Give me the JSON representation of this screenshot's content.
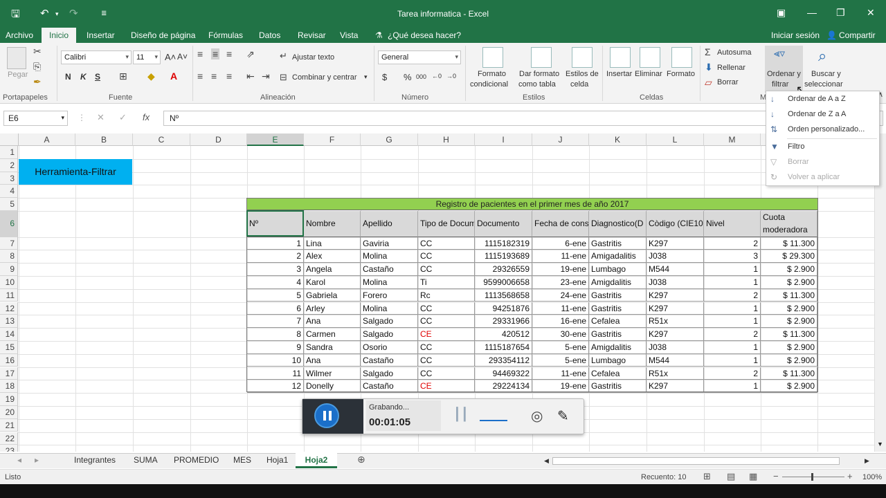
{
  "window": {
    "title": "Tarea informatica - Excel"
  },
  "menu": {
    "tabs": [
      "Archivo",
      "Inicio",
      "Insertar",
      "Diseño de página",
      "Fórmulas",
      "Datos",
      "Revisar",
      "Vista"
    ],
    "tell_me": "¿Qué desea hacer?",
    "signin": "Iniciar sesión",
    "share": "Compartir"
  },
  "ribbon": {
    "clipboard": {
      "paste": "Pegar",
      "label": "Portapapeles"
    },
    "font": {
      "name": "Calibri",
      "size": "11",
      "bold": "N",
      "italic": "K",
      "underline": "S",
      "label": "Fuente"
    },
    "alignment": {
      "wrap": "Ajustar texto",
      "merge": "Combinar y centrar",
      "label": "Alineación"
    },
    "number": {
      "format": "General",
      "label": "Número"
    },
    "styles": {
      "conditional_1": "Formato",
      "conditional_2": "condicional",
      "table_1": "Dar formato",
      "table_2": "como tabla",
      "cell_1": "Estilos de",
      "cell_2": "celda",
      "label": "Estilos"
    },
    "cells": {
      "insert": "Insertar",
      "delete": "Eliminar",
      "format": "Formato",
      "label": "Celdas"
    },
    "editing": {
      "autosum": "Autosuma",
      "fill": "Rellenar",
      "clear": "Borrar",
      "sort_1": "Ordenar y",
      "sort_2": "filtrar",
      "find_1": "Buscar y",
      "find_2": "seleccionar",
      "label": "M"
    }
  },
  "formula_bar": {
    "name_box": "E6",
    "fx": "fx",
    "value": "Nº"
  },
  "grid": {
    "columns": [
      "A",
      "B",
      "C",
      "D",
      "E",
      "F",
      "G",
      "H",
      "I",
      "J",
      "K",
      "L",
      "M",
      "N"
    ],
    "rows": [
      "1",
      "2",
      "3",
      "4",
      "5",
      "6",
      "7",
      "8",
      "9",
      "10",
      "11",
      "12",
      "13",
      "14",
      "15",
      "16",
      "17",
      "18",
      "19",
      "20",
      "21",
      "22",
      "23"
    ],
    "banner": "Herramienta-Filtrar",
    "table_title": "Registro de pacientes en el primer mes de año 2017",
    "headers": [
      "Nº",
      "Nombre",
      "Apellido",
      "Tipo de Docum",
      "Documento",
      "Fecha de cons",
      "Diagnostico(D",
      "Còdigo (CIE10",
      "Nivel",
      "Cuota",
      "moderadora"
    ],
    "records": [
      [
        "1",
        "Lina",
        "Gaviria",
        "CC",
        "1115182319",
        "6-ene",
        "Gastritis",
        "K297",
        "2",
        "$ 11.300"
      ],
      [
        "2",
        "Alex",
        "Molina",
        "CC",
        "1115193689",
        "11-ene",
        "Amigadalitis",
        "J038",
        "3",
        "$ 29.300"
      ],
      [
        "3",
        "Angela",
        "Castaño",
        "CC",
        "29326559",
        "19-ene",
        "Lumbago",
        "M544",
        "1",
        "$ 2.900"
      ],
      [
        "4",
        "Karol",
        "Molina",
        "Ti",
        "9599006658",
        "23-ene",
        "Amigdalitis",
        "J038",
        "1",
        "$ 2.900"
      ],
      [
        "5",
        "Gabriela",
        "Forero",
        "Rc",
        "1113568658",
        "24-ene",
        "Gastritis",
        "K297",
        "2",
        "$ 11.300"
      ],
      [
        "6",
        "Arley",
        "Molina",
        "CC",
        "94251876",
        "11-ene",
        "Gastritis",
        "K297",
        "1",
        "$ 2.900"
      ],
      [
        "7",
        "Ana",
        "Salgado",
        "CC",
        "29331966",
        "16-ene",
        "Cefalea",
        "R51x",
        "1",
        "$ 2.900"
      ],
      [
        "8",
        "Carmen",
        "Salgado",
        "CE",
        "420512",
        "30-ene",
        "Gastritis",
        "K297",
        "2",
        "$ 11.300"
      ],
      [
        "9",
        "Sandra",
        "Osorio",
        "CC",
        "1115187654",
        "5-ene",
        "Amigdalitis",
        "J038",
        "1",
        "$ 2.900"
      ],
      [
        "10",
        "Ana",
        "Castaño",
        "CC",
        "293354112",
        "5-ene",
        "Lumbago",
        "M544",
        "1",
        "$ 2.900"
      ],
      [
        "11",
        "Wilmer",
        "Salgado",
        "CC",
        "94469322",
        "11-ene",
        "Cefalea",
        "R51x",
        "2",
        "$ 11.300"
      ],
      [
        "12",
        "Donelly",
        "Castaño",
        "CE",
        "29224134",
        "19-ene",
        "Gastritis",
        "K297",
        "1",
        "$ 2.900"
      ]
    ]
  },
  "sort_menu": {
    "items": [
      "Ordenar de A a Z",
      "Ordenar de Z a A",
      "Orden personalizado...",
      "Filtro",
      "Borrar",
      "Volver a aplicar"
    ]
  },
  "recorder": {
    "status": "Grabando...",
    "time": "00:01:05"
  },
  "sheets": {
    "tabs": [
      "Integrantes",
      "SUMA",
      "PROMEDIO",
      "MES",
      "Hoja1",
      "Hoja2"
    ],
    "active": "Hoja2"
  },
  "status": {
    "ready": "Listo",
    "count": "Recuento: 10",
    "zoom": "100%"
  },
  "colors": {
    "excel_green": "#217346",
    "banner_blue": "#00b0f0",
    "title_green": "#92d050",
    "header_gray": "#d9d9d9",
    "red_text": "#e00000"
  }
}
